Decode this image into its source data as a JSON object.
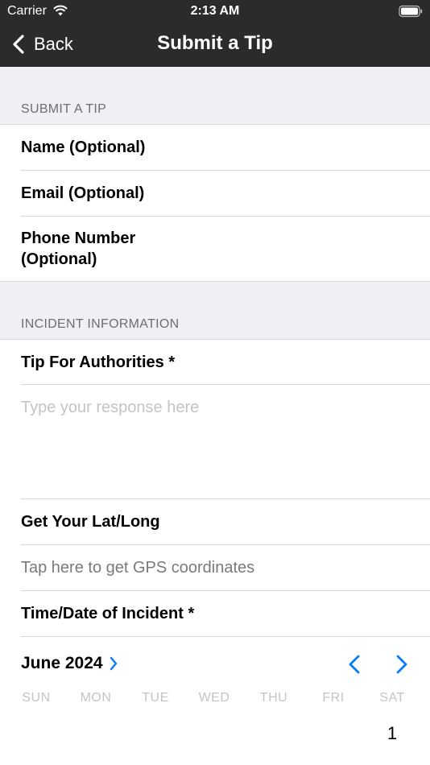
{
  "status": {
    "carrier": "Carrier",
    "time": "2:13 AM"
  },
  "nav": {
    "back_label": "Back",
    "title": "Submit a Tip"
  },
  "sections": {
    "submit_header": "SUBMIT A TIP",
    "incident_header": "INCIDENT INFORMATION"
  },
  "fields": {
    "name": "Name (Optional)",
    "email": "Email (Optional)",
    "phone_line1": "Phone Number",
    "phone_line2": "(Optional)",
    "tip": "Tip For Authorities *",
    "tip_placeholder": "Type your response here",
    "latlong": "Get Your Lat/Long",
    "gps_hint": "Tap here to get GPS coordinates",
    "time_date": "Time/Date of Incident *"
  },
  "calendar": {
    "month": "June 2024",
    "weekdays": [
      "SUN",
      "MON",
      "TUE",
      "WED",
      "THU",
      "FRI",
      "SAT"
    ],
    "first_day": "1",
    "accent": "#0a7aff"
  },
  "colors": {
    "bar": "#2b2b2b",
    "group_bg": "#efeff4",
    "accent": "#0a7aff"
  }
}
